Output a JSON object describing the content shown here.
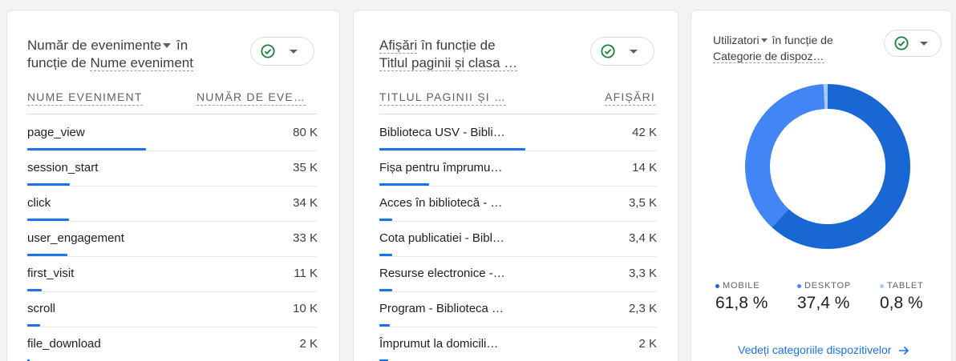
{
  "card_events": {
    "title_part1": "Număr de evenimente",
    "title_part2": " în",
    "title_part3": "funcție de ",
    "title_part4": "Nume eveniment",
    "col_name": "NUME EVENIMENT",
    "col_value": "NUMĂR DE EVE…",
    "rows": [
      {
        "name": "page_view",
        "value": "80 K",
        "bar_fraction": 1.0
      },
      {
        "name": "session_start",
        "value": "35 K",
        "bar_fraction": 0.36
      },
      {
        "name": "click",
        "value": "34 K",
        "bar_fraction": 0.35
      },
      {
        "name": "user_engagement",
        "value": "33 K",
        "bar_fraction": 0.34
      },
      {
        "name": "first_visit",
        "value": "11 K",
        "bar_fraction": 0.12
      },
      {
        "name": "scroll",
        "value": "10 K",
        "bar_fraction": 0.11
      },
      {
        "name": "file_download",
        "value": "2 K",
        "bar_fraction": 0.02
      }
    ]
  },
  "card_pages": {
    "title_part1": "Afișări",
    "title_part2": " în funcție de",
    "title_part3": "Titlul paginii și clasa …",
    "col_name": "TITLUL PAGINII ȘI …",
    "col_value": "AFIȘĂRI",
    "rows": [
      {
        "name": "Biblioteca USV - Bibli…",
        "value": "42 K",
        "bar_fraction": 1.0
      },
      {
        "name": "Fișa pentru împrumu…",
        "value": "14 K",
        "bar_fraction": 0.34
      },
      {
        "name": "Acces în bibliotecă - …",
        "value": "3,5 K",
        "bar_fraction": 0.09
      },
      {
        "name": "Cota publicatiei - Bibl…",
        "value": "3,4 K",
        "bar_fraction": 0.09
      },
      {
        "name": "Resurse electronice -…",
        "value": "3,3 K",
        "bar_fraction": 0.09
      },
      {
        "name": "Program - Biblioteca …",
        "value": "2,3 K",
        "bar_fraction": 0.07
      },
      {
        "name": "Împrumut la domicili…",
        "value": "2 K",
        "bar_fraction": 0.06
      }
    ]
  },
  "card_users": {
    "title_part1": "Utilizatori",
    "title_part2": " în funcție de",
    "title_part3": "Categorie de dispoz…",
    "legend": [
      {
        "label": "MOBILE",
        "pct": "61,8 %",
        "color": "#1967d2"
      },
      {
        "label": "DESKTOP",
        "pct": "37,4 %",
        "color": "#4285f4"
      },
      {
        "label": "TABLET",
        "pct": "0,8 %",
        "color": "#a8c7fa"
      }
    ],
    "link": "Vedeți categoriile dispozitivelor",
    "link_icon": "arrow-right-icon"
  },
  "chart_data": {
    "type": "pie",
    "categories": [
      "MOBILE",
      "DESKTOP",
      "TABLET"
    ],
    "values": [
      61.8,
      37.4,
      0.8
    ],
    "colors": [
      "#1967d2",
      "#4285f4",
      "#a8c7fa"
    ]
  },
  "icons": {
    "status": "check-circle-icon",
    "dropdown": "caret-down-icon"
  },
  "colors": {
    "accent": "#1a73e8",
    "check": "#188038"
  }
}
